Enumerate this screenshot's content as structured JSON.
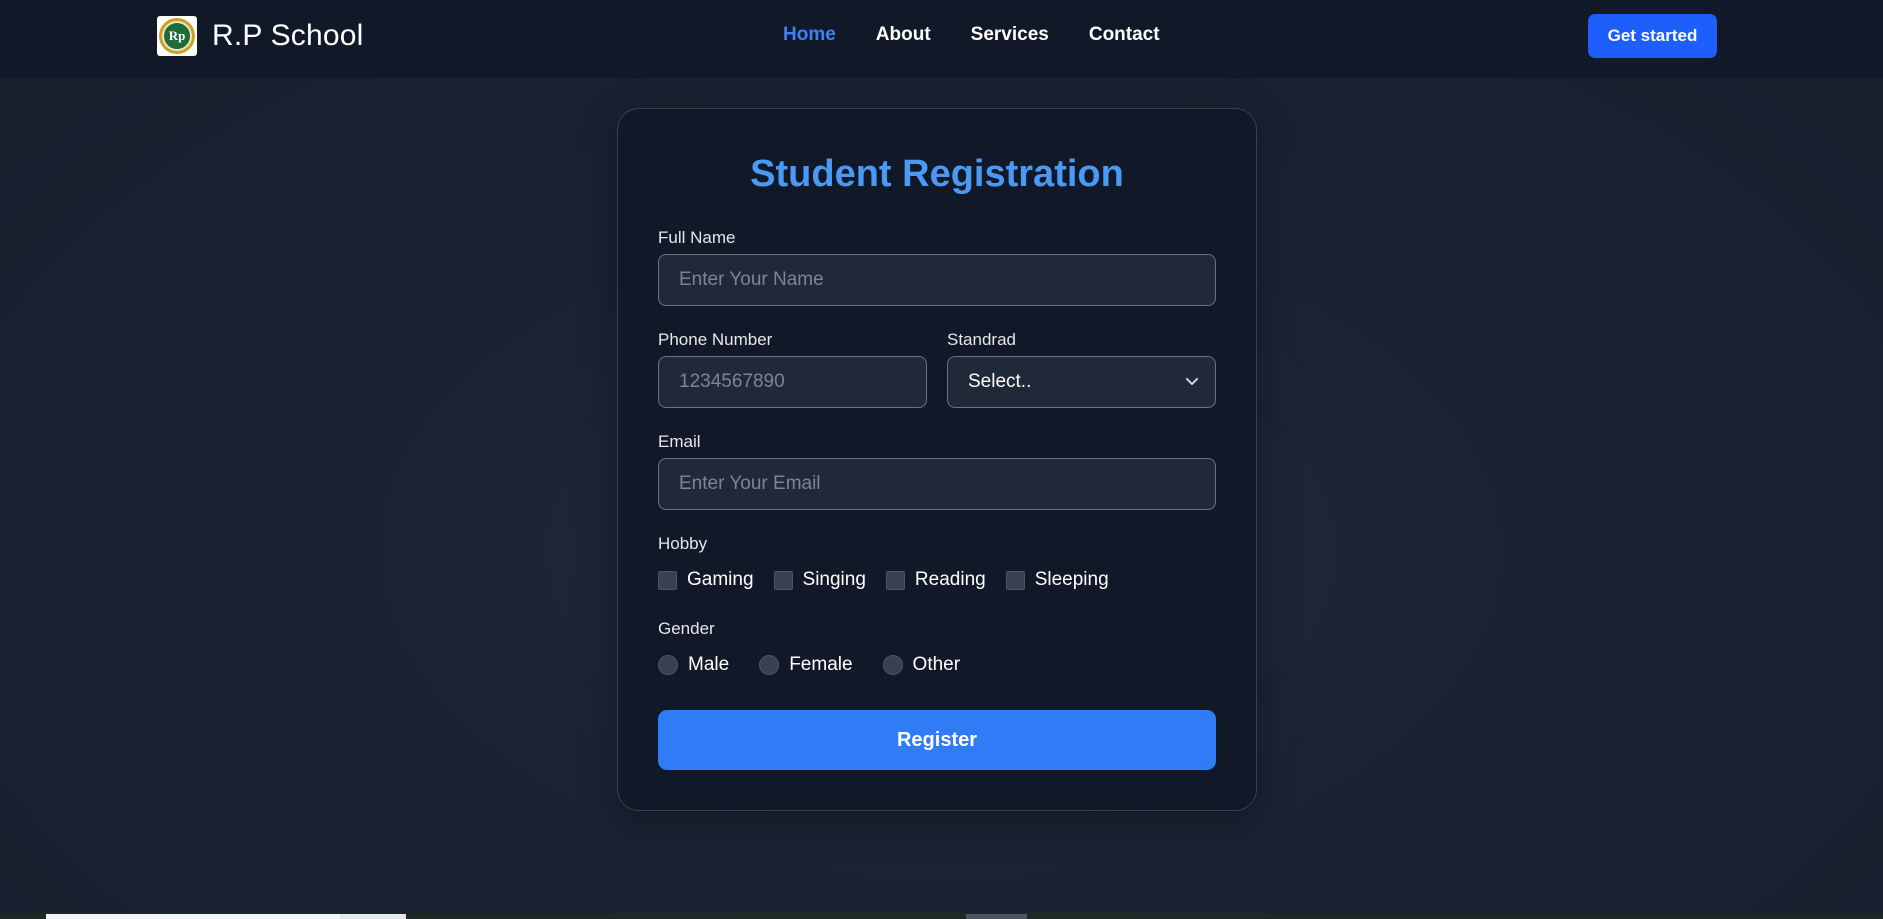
{
  "navbar": {
    "brand": {
      "logo_text": "Rp",
      "name": "R.P School"
    },
    "links": [
      {
        "label": "Home",
        "active": true
      },
      {
        "label": "About",
        "active": false
      },
      {
        "label": "Services",
        "active": false
      },
      {
        "label": "Contact",
        "active": false
      }
    ],
    "cta_label": "Get started"
  },
  "form": {
    "title": "Student Registration",
    "full_name": {
      "label": "Full Name",
      "placeholder": "Enter Your Name",
      "value": ""
    },
    "phone": {
      "label": "Phone Number",
      "placeholder": "1234567890",
      "value": ""
    },
    "standard": {
      "label": "Standrad",
      "selected": "Select.."
    },
    "email": {
      "label": "Email",
      "placeholder": "Enter Your Email",
      "value": ""
    },
    "hobby": {
      "label": "Hobby",
      "options": [
        {
          "label": "Gaming",
          "checked": false
        },
        {
          "label": "Singing",
          "checked": false
        },
        {
          "label": "Reading",
          "checked": false
        },
        {
          "label": "Sleeping",
          "checked": false
        }
      ]
    },
    "gender": {
      "label": "Gender",
      "options": [
        {
          "label": "Male",
          "checked": false
        },
        {
          "label": "Female",
          "checked": false
        },
        {
          "label": "Other",
          "checked": false
        }
      ]
    },
    "submit_label": "Register"
  },
  "colors": {
    "accent": "#3b82f6",
    "title": "#4a9af5",
    "cta": "#1d5efc",
    "card_bg": "#111827",
    "page_bg": "#1a2333"
  }
}
